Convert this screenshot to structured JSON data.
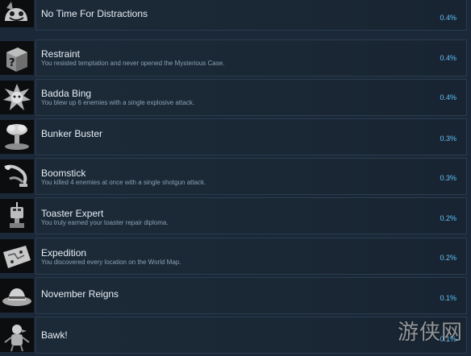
{
  "achievements": [
    {
      "title": "No Time For Distractions",
      "description": "",
      "percent": "0.4%",
      "icon": "cartoon-dog-icon"
    },
    {
      "title": "Restraint",
      "description": "You resisted temptation and never opened the Mysterious Case.",
      "percent": "0.4%",
      "icon": "mystery-box-icon"
    },
    {
      "title": "Badda Bing",
      "description": "You blew up 6 enemies with a single explosive attack.",
      "percent": "0.4%",
      "icon": "explosion-icon"
    },
    {
      "title": "Bunker Buster",
      "description": "",
      "percent": "0.3%",
      "icon": "mushroom-cloud-icon"
    },
    {
      "title": "Boomstick",
      "description": "You killed 4 enemies at once with a single shotgun attack.",
      "percent": "0.3%",
      "icon": "shotgun-icon"
    },
    {
      "title": "Toaster Expert",
      "description": "You truly earned your toaster repair diploma.",
      "percent": "0.2%",
      "icon": "toaster-robot-icon"
    },
    {
      "title": "Expedition",
      "description": "You discovered every location on the World Map.",
      "percent": "0.2%",
      "icon": "map-icon"
    },
    {
      "title": "November Reigns",
      "description": "",
      "percent": "0.1%",
      "icon": "fedora-hat-icon"
    },
    {
      "title": "Bawk!",
      "description": "",
      "percent": "0.1%",
      "icon": "chicken-robot-icon"
    }
  ],
  "watermark": "游侠网",
  "colors": {
    "background": "#1b2838",
    "percent": "#66c0f4",
    "title": "#e6eef5",
    "description": "#8ba1b3"
  }
}
